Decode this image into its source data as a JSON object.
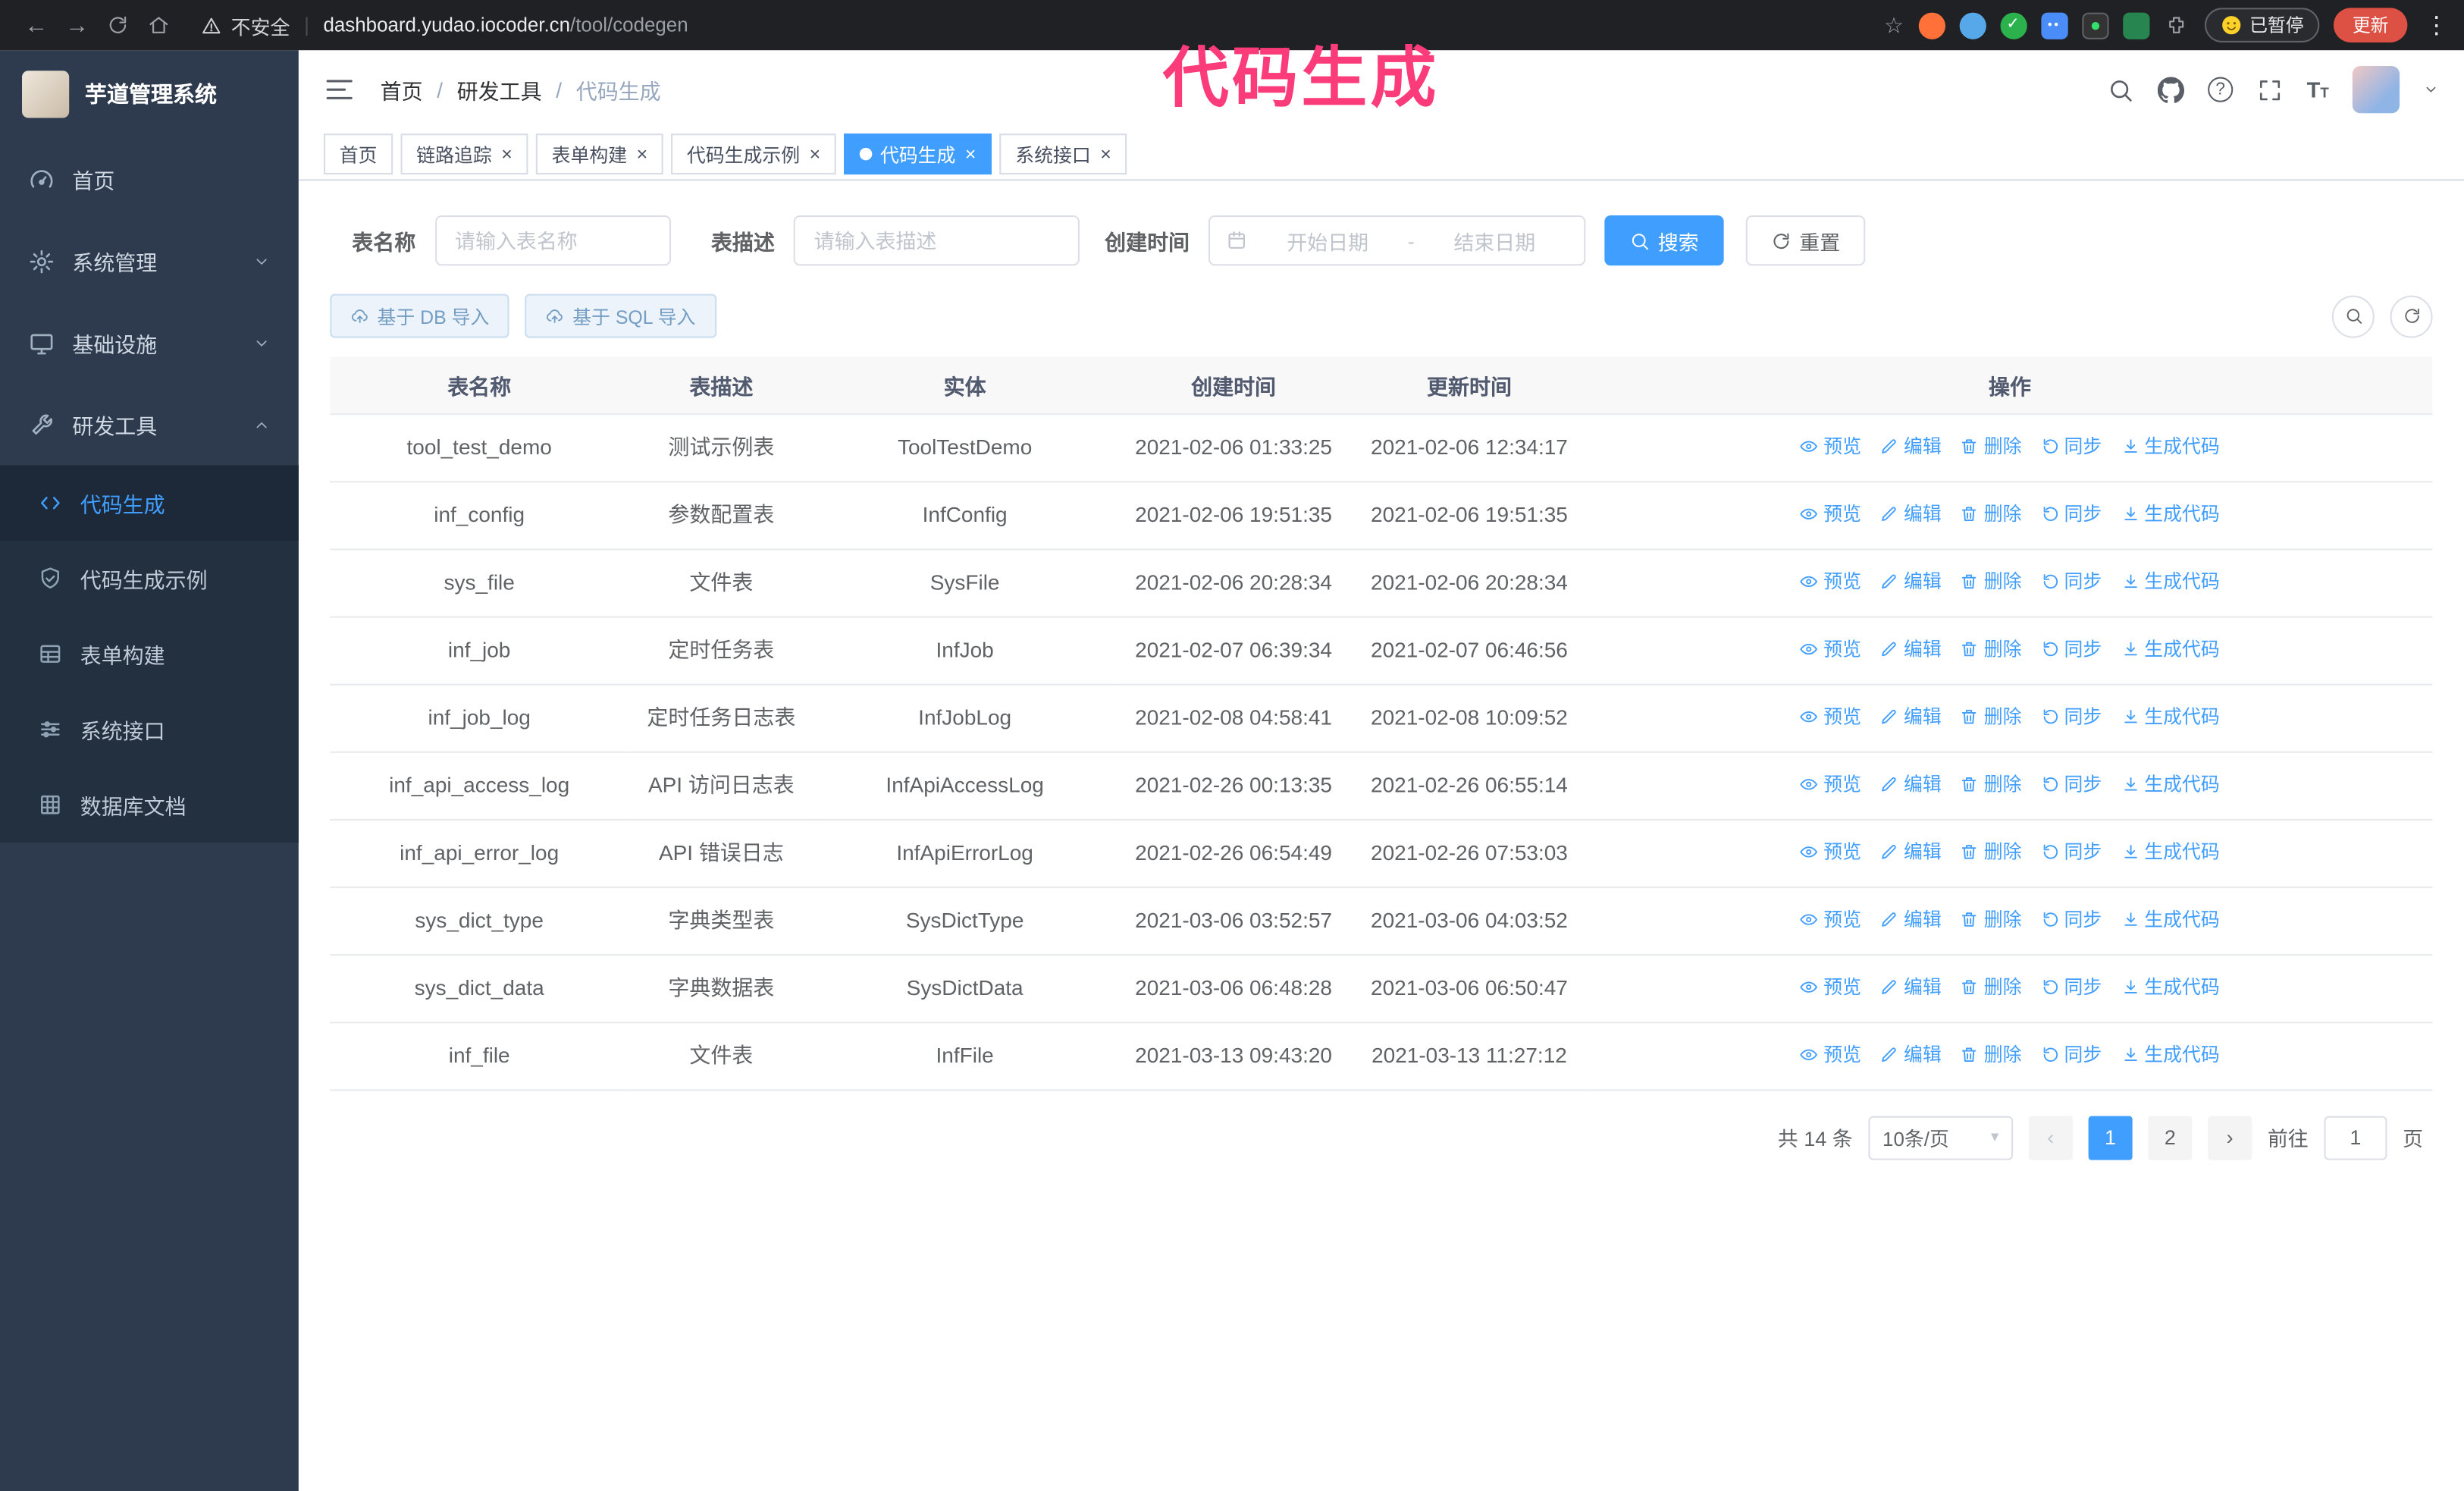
{
  "colors": {
    "primary": "#409EFF",
    "annotation": "#FB3B7A",
    "sidebar_bg": "#2e3b4e"
  },
  "annotation": {
    "text": "代码生成"
  },
  "browser": {
    "warning_text": "不安全",
    "url_host": "dashboard.yudao.iocoder.cn",
    "url_path": "/tool/codegen",
    "paused_label": "已暂停",
    "update_label": "更新"
  },
  "sidebar": {
    "title": "芋道管理系统",
    "items": [
      {
        "label": "首页"
      },
      {
        "label": "系统管理"
      },
      {
        "label": "基础设施"
      },
      {
        "label": "研发工具"
      }
    ],
    "subitems": [
      {
        "label": "代码生成",
        "active": true
      },
      {
        "label": "代码生成示例"
      },
      {
        "label": "表单构建"
      },
      {
        "label": "系统接口"
      },
      {
        "label": "数据库文档"
      }
    ]
  },
  "breadcrumb": {
    "items": [
      "首页",
      "研发工具",
      "代码生成"
    ],
    "separator": "/"
  },
  "tabs": [
    {
      "label": "首页",
      "closable": false,
      "active": false
    },
    {
      "label": "链路追踪",
      "closable": true,
      "active": false
    },
    {
      "label": "表单构建",
      "closable": true,
      "active": false
    },
    {
      "label": "代码生成示例",
      "closable": true,
      "active": false
    },
    {
      "label": "代码生成",
      "closable": true,
      "active": true
    },
    {
      "label": "系统接口",
      "closable": true,
      "active": false
    }
  ],
  "filters": {
    "table_name_label": "表名称",
    "table_name_placeholder": "请输入表名称",
    "table_desc_label": "表描述",
    "table_desc_placeholder": "请输入表描述",
    "create_time_label": "创建时间",
    "start_date_placeholder": "开始日期",
    "range_separator": "-",
    "end_date_placeholder": "结束日期",
    "search_button": "搜索",
    "reset_button": "重置"
  },
  "toolbar": {
    "import_db_button": "基于 DB 导入",
    "import_sql_button": "基于 SQL 导入"
  },
  "table": {
    "columns": [
      "表名称",
      "表描述",
      "实体",
      "创建时间",
      "更新时间",
      "操作"
    ],
    "actions": [
      "预览",
      "编辑",
      "删除",
      "同步",
      "生成代码"
    ],
    "rows": [
      {
        "name": "tool_test_demo",
        "desc": "测试示例表",
        "entity": "ToolTestDemo",
        "created": "2021-02-06 01:33:25",
        "updated": "2021-02-06 12:34:17"
      },
      {
        "name": "inf_config",
        "desc": "参数配置表",
        "entity": "InfConfig",
        "created": "2021-02-06 19:51:35",
        "updated": "2021-02-06 19:51:35"
      },
      {
        "name": "sys_file",
        "desc": "文件表",
        "entity": "SysFile",
        "created": "2021-02-06 20:28:34",
        "updated": "2021-02-06 20:28:34"
      },
      {
        "name": "inf_job",
        "desc": "定时任务表",
        "entity": "InfJob",
        "created": "2021-02-07 06:39:34",
        "updated": "2021-02-07 06:46:56"
      },
      {
        "name": "inf_job_log",
        "desc": "定时任务日志表",
        "entity": "InfJobLog",
        "created": "2021-02-08 04:58:41",
        "updated": "2021-02-08 10:09:52"
      },
      {
        "name": "inf_api_access_log",
        "desc": "API 访问日志表",
        "entity": "InfApiAccessLog",
        "created": "2021-02-26 00:13:35",
        "updated": "2021-02-26 06:55:14"
      },
      {
        "name": "inf_api_error_log",
        "desc": "API 错误日志",
        "entity": "InfApiErrorLog",
        "created": "2021-02-26 06:54:49",
        "updated": "2021-02-26 07:53:03"
      },
      {
        "name": "sys_dict_type",
        "desc": "字典类型表",
        "entity": "SysDictType",
        "created": "2021-03-06 03:52:57",
        "updated": "2021-03-06 04:03:52"
      },
      {
        "name": "sys_dict_data",
        "desc": "字典数据表",
        "entity": "SysDictData",
        "created": "2021-03-06 06:48:28",
        "updated": "2021-03-06 06:50:47"
      },
      {
        "name": "inf_file",
        "desc": "文件表",
        "entity": "InfFile",
        "created": "2021-03-13 09:43:20",
        "updated": "2021-03-13 11:27:12"
      }
    ]
  },
  "pagination": {
    "total": "共 14 条",
    "page_size": "10条/页",
    "pages": [
      "1",
      "2"
    ],
    "current": "1",
    "goto_label": "前往",
    "goto_value": "1",
    "goto_suffix": "页"
  }
}
